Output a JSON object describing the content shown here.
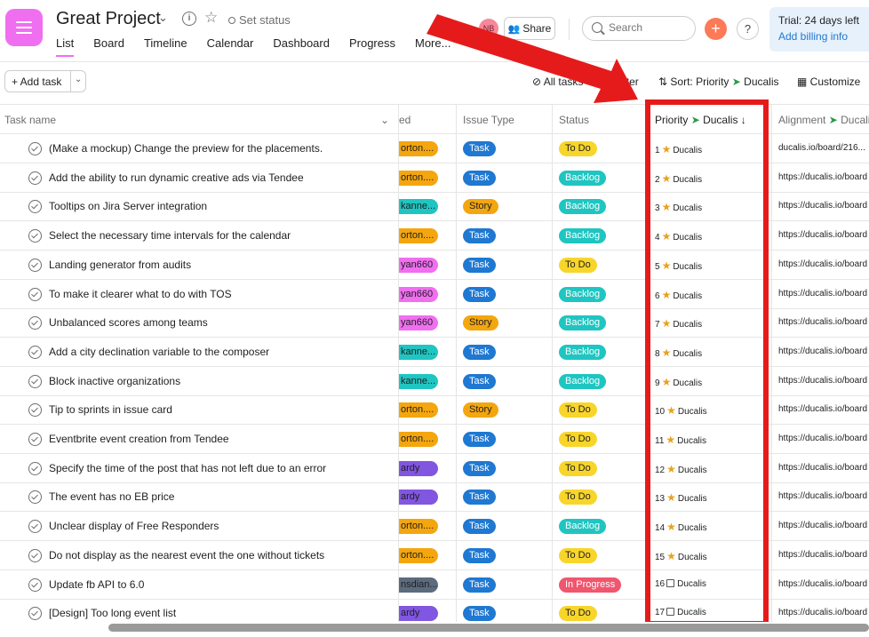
{
  "header": {
    "project_title": "Great Project",
    "set_status": "Set status",
    "tabs": [
      "List",
      "Board",
      "Timeline",
      "Calendar",
      "Dashboard",
      "Progress",
      "More..."
    ],
    "avatar_initials": "NB",
    "share_label": "Share",
    "search_placeholder": "Search",
    "trial_text": "Trial: 24 days left",
    "billing_link": "Add billing info"
  },
  "toolbar": {
    "add_task_label": "+ Add task",
    "all_tasks": "All tasks",
    "filter": "Filter",
    "sort": "Sort: Priority",
    "sort_app": "Ducalis",
    "customize": "Customize"
  },
  "columns": {
    "task_name": "Task name",
    "assignee": "ed",
    "issue_type": "Issue Type",
    "status": "Status",
    "priority": "Priority",
    "priority_app": "Ducalis",
    "alignment": "Alignment",
    "alignment_app": "Ducali"
  },
  "colors": {
    "orange": "#f4a60e",
    "teal": "#1fc5c1",
    "pink": "#f06ef0",
    "purple": "#8156e0",
    "slate": "#5d6b7e",
    "task_blue": "#1f78d1",
    "story_orange": "#f4a60e",
    "todo_yellow": "#f8d52a",
    "backlog_teal": "#1fc5c1",
    "inprogress_red": "#f0566e",
    "annotation_red": "#e51b1b"
  },
  "rows": [
    {
      "name": "(Make a mockup) Change the preview for the placements.",
      "assignee": "orton....",
      "assignee_color": "orange",
      "issue": "Task",
      "status": "To Do",
      "priority": "1",
      "prio_icon": "star",
      "alignment": "ducalis.io/board/216..."
    },
    {
      "name": "Add the ability to run dynamic creative ads via Tendee",
      "assignee": "orton....",
      "assignee_color": "orange",
      "issue": "Task",
      "status": "Backlog",
      "priority": "2",
      "prio_icon": "star",
      "alignment": "https://ducalis.io/board"
    },
    {
      "name": "Tooltips on Jira Server integration",
      "assignee": "kanne...",
      "assignee_color": "teal",
      "issue": "Story",
      "status": "Backlog",
      "priority": "3",
      "prio_icon": "star",
      "alignment": "https://ducalis.io/board"
    },
    {
      "name": "Select the necessary time intervals for the calendar",
      "assignee": "orton....",
      "assignee_color": "orange",
      "issue": "Task",
      "status": "Backlog",
      "priority": "4",
      "prio_icon": "star",
      "alignment": "https://ducalis.io/board"
    },
    {
      "name": "Landing generator from audits",
      "assignee": "yan660",
      "assignee_color": "pink",
      "issue": "Task",
      "status": "To Do",
      "priority": "5",
      "prio_icon": "star",
      "alignment": "https://ducalis.io/board"
    },
    {
      "name": "To make it clearer what to do with TOS",
      "assignee": "yan660",
      "assignee_color": "pink",
      "issue": "Task",
      "status": "Backlog",
      "priority": "6",
      "prio_icon": "star",
      "alignment": "https://ducalis.io/board"
    },
    {
      "name": "Unbalanced scores among teams",
      "assignee": "yan660",
      "assignee_color": "pink",
      "issue": "Story",
      "status": "Backlog",
      "priority": "7",
      "prio_icon": "star",
      "alignment": "https://ducalis.io/board"
    },
    {
      "name": "Add a city declination variable to the composer",
      "assignee": "kanne...",
      "assignee_color": "teal",
      "issue": "Task",
      "status": "Backlog",
      "priority": "8",
      "prio_icon": "star",
      "alignment": "https://ducalis.io/board"
    },
    {
      "name": "Block inactive organizations",
      "assignee": "kanne...",
      "assignee_color": "teal",
      "issue": "Task",
      "status": "Backlog",
      "priority": "9",
      "prio_icon": "star",
      "alignment": "https://ducalis.io/board"
    },
    {
      "name": "Tip to sprints in issue card",
      "assignee": "orton....",
      "assignee_color": "orange",
      "issue": "Story",
      "status": "To Do",
      "priority": "10",
      "prio_icon": "star",
      "alignment": "https://ducalis.io/board"
    },
    {
      "name": "Eventbrite event creation from Tendee",
      "assignee": "orton....",
      "assignee_color": "orange",
      "issue": "Task",
      "status": "To Do",
      "priority": "11",
      "prio_icon": "star",
      "alignment": "https://ducalis.io/board"
    },
    {
      "name": "Specify the time of the post that has not left due to an error",
      "assignee": "ardy",
      "assignee_color": "purple",
      "issue": "Task",
      "status": "To Do",
      "priority": "12",
      "prio_icon": "star",
      "alignment": "https://ducalis.io/board"
    },
    {
      "name": "The event has no EB price",
      "assignee": "ardy",
      "assignee_color": "purple",
      "issue": "Task",
      "status": "To Do",
      "priority": "13",
      "prio_icon": "star",
      "alignment": "https://ducalis.io/board"
    },
    {
      "name": "Unclear display of Free Responders",
      "assignee": "orton....",
      "assignee_color": "orange",
      "issue": "Task",
      "status": "Backlog",
      "priority": "14",
      "prio_icon": "star",
      "alignment": "https://ducalis.io/board"
    },
    {
      "name": "Do not display as the nearest event the one without tickets",
      "assignee": "orton....",
      "assignee_color": "orange",
      "issue": "Task",
      "status": "To Do",
      "priority": "15",
      "prio_icon": "star",
      "alignment": "https://ducalis.io/board"
    },
    {
      "name": "Update fb API to 6.0",
      "assignee": "nsdian...",
      "assignee_color": "slate",
      "issue": "Task",
      "status": "In Progress",
      "priority": "16",
      "prio_icon": "board",
      "alignment": "https://ducalis.io/board"
    },
    {
      "name": "[Design] Too long event list",
      "assignee": "ardy",
      "assignee_color": "purple",
      "issue": "Task",
      "status": "To Do",
      "priority": "17",
      "prio_icon": "board",
      "alignment": "https://ducalis.io/board"
    }
  ]
}
